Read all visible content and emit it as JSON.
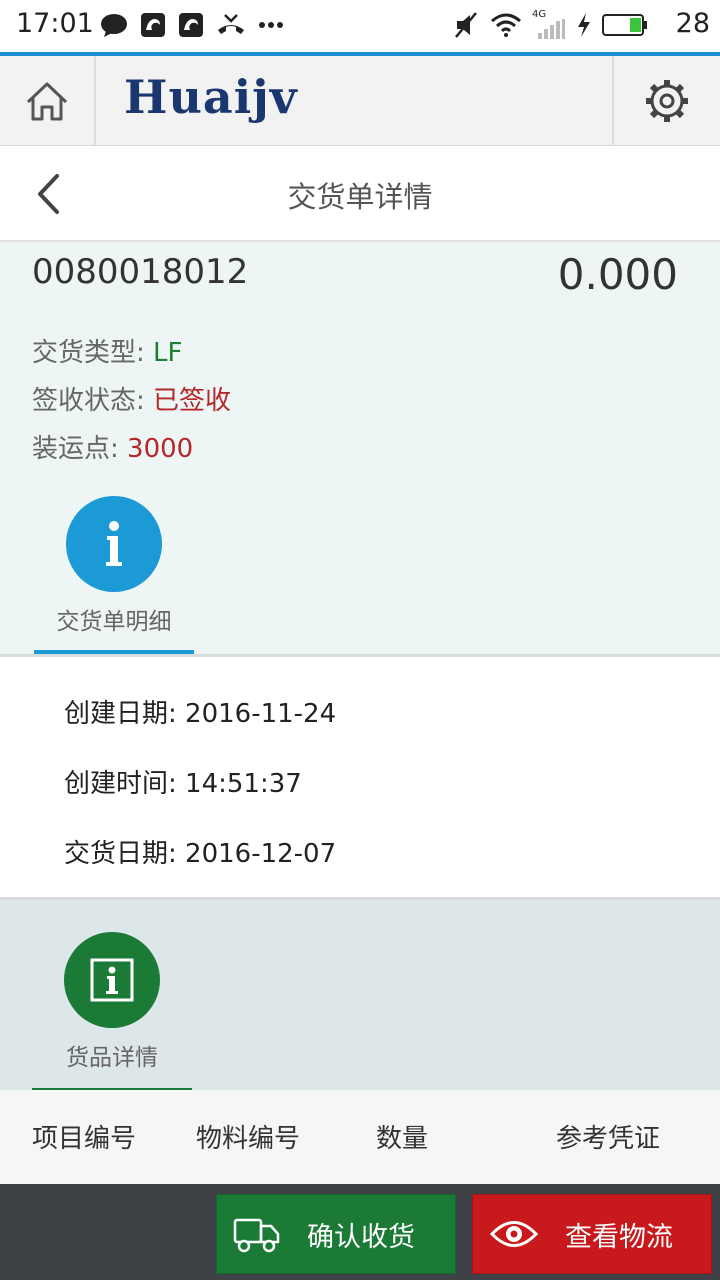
{
  "status_bar": {
    "time": "17:01",
    "battery_level": "28",
    "network": "4G",
    "icons_left": [
      "chat-icon",
      "uc-browser-icon",
      "uc-browser-icon",
      "missed-call-icon",
      "more-dots-icon"
    ],
    "icons_right": [
      "mute-icon",
      "wifi-icon",
      "signal-icon",
      "charging-icon",
      "battery-icon"
    ]
  },
  "header": {
    "logo": "Huaijv",
    "home_icon": "home-icon",
    "settings_icon": "gear-icon"
  },
  "page": {
    "title": "交货单详情",
    "back_icon": "chevron-left-icon"
  },
  "summary": {
    "doc_number": "0080018012",
    "amount": "0.000",
    "delivery_type_label": "交货类型:",
    "delivery_type_value": "LF",
    "sign_status_label": "签收状态:",
    "sign_status_value": "已签收",
    "shipping_point_label": "装运点:",
    "shipping_point_value": "3000"
  },
  "detail_tab": {
    "label": "交货单明细",
    "color": "#1b9ad6"
  },
  "details": {
    "created_date_label": "创建日期:",
    "created_date_value": "2016-11-24",
    "created_time_label": "创建时间:",
    "created_time_value": "14:51:37",
    "delivery_date_label": "交货日期:",
    "delivery_date_value": "2016-12-07"
  },
  "goods_tab": {
    "label": "货品详情",
    "color": "#1a7a36"
  },
  "goods_table": {
    "columns": [
      "项目编号",
      "物料编号",
      "数量",
      "参考凭证"
    ]
  },
  "actions": {
    "confirm_label": "确认收货",
    "confirm_icon": "truck-icon",
    "confirm_color": "#1a7a36",
    "track_label": "查看物流",
    "track_icon": "eye-icon",
    "track_color": "#c8191c"
  }
}
